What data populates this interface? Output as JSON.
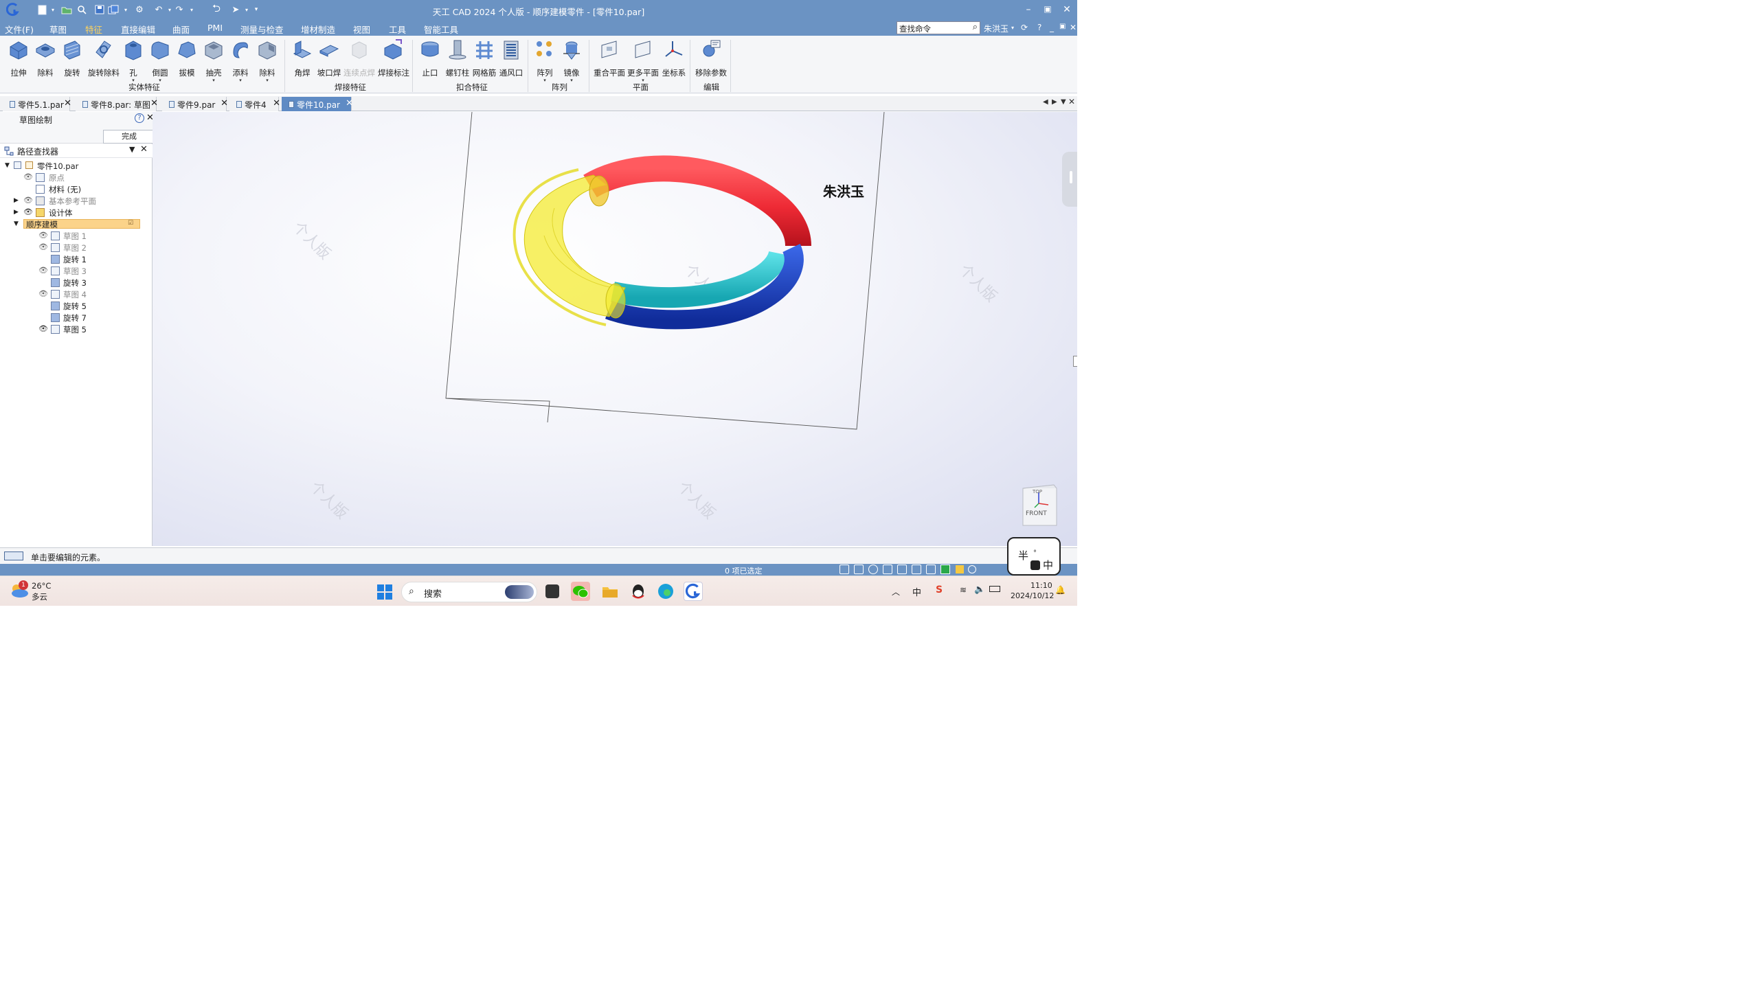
{
  "window": {
    "title": "天工 CAD 2024 个人版 - 顺序建模零件 - [零件10.par]",
    "controls": {
      "minimize": "–",
      "maximize": "▣",
      "close": "✕"
    }
  },
  "menu": {
    "items": [
      "文件(F)",
      "草图",
      "特征",
      "直接编辑",
      "曲面",
      "PMI",
      "测量与检查",
      "增材制造",
      "视图",
      "工具",
      "智能工具"
    ],
    "active_index": 2,
    "search_placeholder": "查找命令",
    "user": "朱洪玉",
    "help": "?"
  },
  "ribbon": {
    "solid_group": "实体特征",
    "weld_group": "焊接特征",
    "snap_group": "扣合特征",
    "array_group": "阵列",
    "plane_group": "平面",
    "edit_group": "编辑",
    "buttons": {
      "extrude": "拉伸",
      "cutout": "除料",
      "revolve": "旋转",
      "revolve_cut": "旋转除料",
      "hole": "孔",
      "round": "倒圆",
      "draft": "拔模",
      "shell": "抽壳",
      "add_material": "添料",
      "remove_material": "除料",
      "fillet_weld": "角焊",
      "groove_weld": "坡口焊",
      "stitch_weld": "连续点焊",
      "weld_label": "焊接标注",
      "lip": "止口",
      "screw_post": "螺钉柱",
      "web": "网格筋",
      "vent": "通风口",
      "pattern": "阵列",
      "mirror": "镜像",
      "coincident_plane": "重合平面",
      "more_planes": "更多平面",
      "coord_sys": "坐标系",
      "remove_params": "移除参数"
    }
  },
  "tabs": [
    {
      "label": "零件5.1.par",
      "active": false
    },
    {
      "label": "零件8.par: 草图",
      "active": false
    },
    {
      "label": "零件9.par",
      "active": false
    },
    {
      "label": "零件4",
      "active": false
    },
    {
      "label": "零件10.par",
      "active": true
    }
  ],
  "sketch_panel": {
    "title": "草图绘制",
    "done": "完成"
  },
  "pathfinder": {
    "title": "路径查找器",
    "root": "零件10.par",
    "items": {
      "origin": "原点",
      "material": "材料 (无)",
      "base_planes": "基本参考平面",
      "design_body": "设计体",
      "ordered": "顺序建模",
      "sketch1": "草图 1",
      "sketch2": "草图 2",
      "revolve1": "旋转 1",
      "sketch3": "草图 3",
      "revolve3": "旋转 3",
      "sketch4": "草图 4",
      "revolve5": "旋转 5",
      "revolve7": "旋转 7",
      "sketch5": "草图 5"
    }
  },
  "viewport": {
    "annotation": "朱洪玉",
    "watermark": "个人版",
    "view_cube_top": "TOP",
    "view_cube_front": "FRONT"
  },
  "status": {
    "prompt": "单击要编辑的元素。",
    "selection": "0 项已选定"
  },
  "ime": {
    "half": "半",
    "dot": "°",
    "cn": "中"
  },
  "taskbar": {
    "weather_temp": "26°C",
    "weather_desc": "多云",
    "weather_badge": "1",
    "search": "搜索",
    "ime": "中",
    "time": "11:10",
    "date": "2024/10/12"
  },
  "colors": {
    "titlebar": "#6b93c3",
    "ring_red": "#ee2a35",
    "ring_blue": "#1b3fc4",
    "ring_cyan": "#29c7cf",
    "ring_yellow": "#f4ea2a"
  }
}
